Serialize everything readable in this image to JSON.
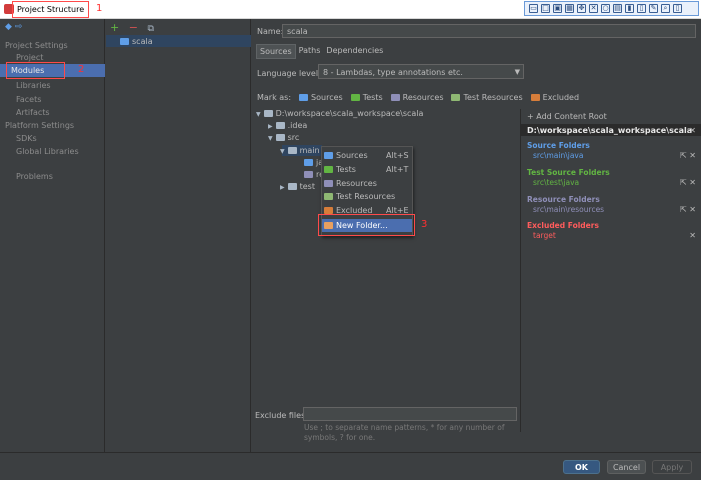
{
  "title_bar": {
    "title": "Project Structure",
    "annotation": "1"
  },
  "left_nav": {
    "section_project_settings": "Project Settings",
    "project": "Project",
    "modules": "Modules",
    "modules_annotation": "2",
    "libraries": "Libraries",
    "facets": "Facets",
    "artifacts": "Artifacts",
    "section_platform_settings": "Platform Settings",
    "sdks": "SDKs",
    "global_libraries": "Global Libraries",
    "problems": "Problems",
    "help": "?"
  },
  "module_list": {
    "add": "+",
    "remove": "−",
    "items": [
      "scala"
    ]
  },
  "module": {
    "name_label": "Name:",
    "name_value": "scala",
    "tabs": [
      "Sources",
      "Paths",
      "Dependencies"
    ],
    "language_level_label": "Language level:",
    "language_level_value": "8 - Lambdas, type annotations etc.",
    "mark_as_label": "Mark as:",
    "mark_as_options": [
      "Sources",
      "Tests",
      "Resources",
      "Test Resources",
      "Excluded"
    ],
    "tree": {
      "root": "D:\\workspace\\scala_workspace\\scala",
      "idea": ".idea",
      "src": "src",
      "main": "main",
      "java_partial": "ja",
      "res_partial": "re",
      "test": "test"
    },
    "exclude_files_label": "Exclude files:",
    "exclude_files_value": "",
    "exclude_hint": "Use ; to separate name patterns, * for any number of symbols, ? for one."
  },
  "context_menu": {
    "items": [
      {
        "label": "Sources",
        "shortcut": "Alt+S"
      },
      {
        "label": "Tests",
        "shortcut": "Alt+T"
      },
      {
        "label": "Resources",
        "shortcut": ""
      },
      {
        "label": "Test Resources",
        "shortcut": ""
      },
      {
        "label": "Excluded",
        "shortcut": "Alt+E"
      },
      {
        "label": "New Folder...",
        "shortcut": ""
      }
    ],
    "annotation": "3"
  },
  "content_root": {
    "add_label": "+ Add Content Root",
    "path": "D:\\workspace\\scala_workspace\\scala",
    "source_title": "Source Folders",
    "source_path": "src\\main\\java",
    "test_title": "Test Source Folders",
    "test_path": "src\\test\\java",
    "resource_title": "Resource Folders",
    "resource_path": "src\\main\\resources",
    "excluded_title": "Excluded Folders",
    "excluded_path": "target"
  },
  "buttons": {
    "ok": "OK",
    "cancel": "Cancel",
    "apply": "Apply"
  },
  "colors": {
    "background": "#3c3f41",
    "selection": "#4b6eaf",
    "source": "#5f9ee8",
    "test": "#62b543",
    "resource": "#8f8fb8",
    "excluded": "#ff5c5c",
    "annotation": "#ff3030"
  }
}
